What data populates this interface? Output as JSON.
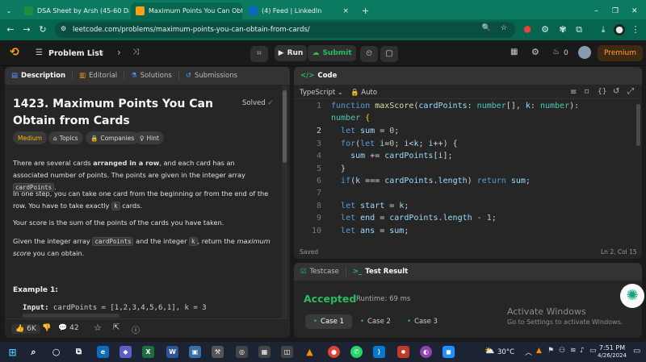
{
  "browser": {
    "tabs": [
      {
        "title": "DSA Sheet by Arsh (45-60 Days",
        "close": "×",
        "color": "#1e8e3e"
      },
      {
        "title": "Maximum Points You Can Obtain",
        "close": "×",
        "color": "#ffa116"
      },
      {
        "title": "(4) Feed | LinkedIn",
        "close": "×",
        "color": "#0a66c2"
      }
    ],
    "new_tab": "+",
    "url": "leetcode.com/problems/maximum-points-you-can-obtain-from-cards/",
    "window_controls": [
      "–",
      "❐",
      "✕"
    ]
  },
  "nav": {
    "problem_list": "Problem List",
    "run": "Run",
    "submit": "Submit",
    "streak": "0",
    "premium": "Premium"
  },
  "left_panel": {
    "tabs": [
      "Description",
      "Editorial",
      "Solutions",
      "Submissions"
    ],
    "title": "1423. Maximum Points You Can Obtain from Cards",
    "status": "Solved",
    "chips": [
      "Medium",
      "Topics",
      "Companies",
      "Hint"
    ],
    "p1_a": "There are several cards ",
    "p1_b": "arranged in a row",
    "p1_c": ", and each card has an associated number of points. The points are given in the integer array ",
    "p1_code": "cardPoints",
    "p1_d": ".",
    "p2_a": "In one step, you can take one card from the beginning or from the end of the row. You have to take exactly ",
    "p2_code": "k",
    "p2_b": " cards.",
    "p3": "Your score is the sum of the points of the cards you have taken.",
    "p4_a": "Given the integer array ",
    "p4_code1": "cardPoints",
    "p4_b": " and the integer ",
    "p4_code2": "k",
    "p4_c": ", return the ",
    "p4_em": "maximum score",
    "p4_d": " you can obtain.",
    "example_title": "Example 1:",
    "input_label": "Input:",
    "input_value": " cardPoints = [1,2,3,4,5,6,1], k = 3",
    "likes": "6K",
    "comments": "42"
  },
  "editor": {
    "title": "Code",
    "language": "TypeScript",
    "mode": "Auto",
    "saved": "Saved",
    "cursor": "Ln 2, Col 15",
    "lines": [
      "1",
      "2",
      "3",
      "4",
      "5",
      "6",
      "7",
      "8",
      "9",
      "10"
    ]
  },
  "results": {
    "tab1": "Testcase",
    "tab2": "Test Result",
    "verdict": "Accepted",
    "runtime": "Runtime: 69 ms",
    "cases": [
      "Case 1",
      "Case 2",
      "Case 3"
    ]
  },
  "watermark": {
    "line1": "Activate Windows",
    "line2": "Go to Settings to activate Windows."
  },
  "taskbar": {
    "temp": "30°C",
    "time": "7:51 PM",
    "date": "4/26/2024"
  }
}
